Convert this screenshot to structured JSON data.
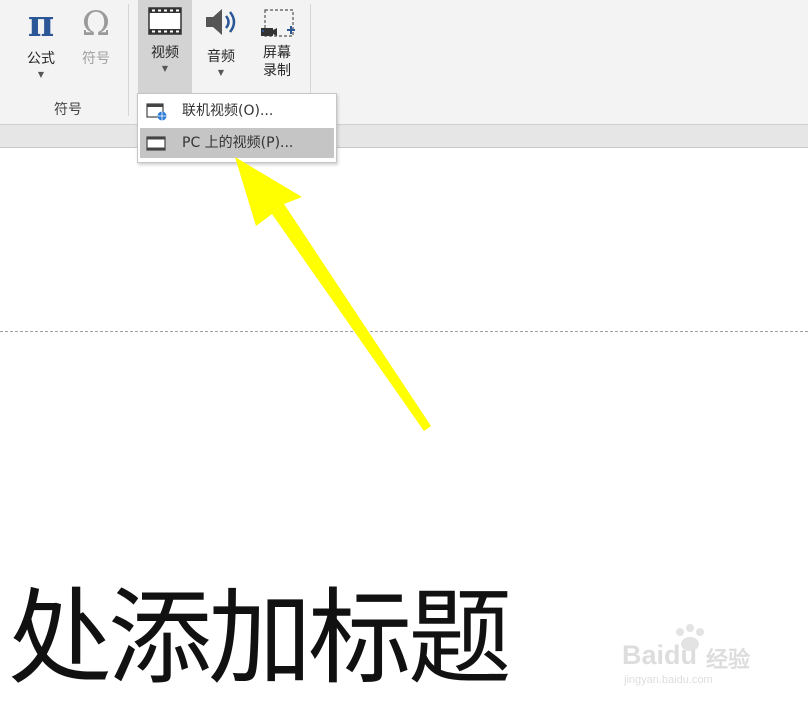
{
  "ribbon": {
    "equation_label": "公式",
    "symbol_label": "符号",
    "symbols_group_label": "符号",
    "video_label": "视频",
    "audio_label": "音频",
    "screen_record_label_line1": "屏幕",
    "screen_record_label_line2": "录制"
  },
  "video_menu": {
    "items": [
      {
        "label": "联机视频(O)..."
      },
      {
        "label": "PC 上的视频(P)..."
      }
    ]
  },
  "slide": {
    "title_text": "处添加标题"
  },
  "watermark": {
    "brand": "Baidu",
    "brand_cn": "经验",
    "url": "jingyan.baidu.com"
  },
  "colors": {
    "ribbon_bg": "#f3f3f3",
    "pressed_bg": "#d3d3d3",
    "menu_hover": "#c5c5c5",
    "arrow": "#ffff00",
    "pi_icon": "#2b5797",
    "audio_icon": "#2b5797"
  }
}
